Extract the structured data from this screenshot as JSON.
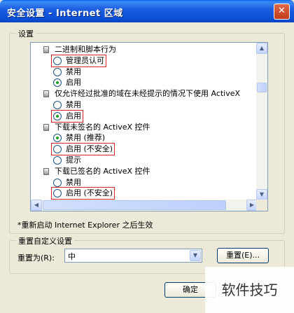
{
  "window": {
    "title": "安全设置 - Internet 区域",
    "close_glyph": "✕"
  },
  "settings_group": {
    "label": "设置"
  },
  "settings_list": [
    {
      "kind": "category",
      "text": "二进制和脚本行为"
    },
    {
      "kind": "option",
      "text": "管理员认可",
      "checked": false,
      "highlighted": true
    },
    {
      "kind": "option",
      "text": "禁用",
      "checked": false,
      "highlighted": false
    },
    {
      "kind": "option",
      "text": "启用",
      "checked": true,
      "highlighted": false
    },
    {
      "kind": "category",
      "text": "仅允许经过批准的域在未经提示的情况下使用 ActiveX"
    },
    {
      "kind": "option",
      "text": "禁用",
      "checked": false,
      "highlighted": false
    },
    {
      "kind": "option",
      "text": "启用",
      "checked": true,
      "highlighted": true
    },
    {
      "kind": "category",
      "text": "下载未签名的 ActiveX 控件"
    },
    {
      "kind": "option",
      "text": "禁用 (推荐)",
      "checked": true,
      "highlighted": false
    },
    {
      "kind": "option",
      "text": "启用 (不安全)",
      "checked": false,
      "highlighted": true
    },
    {
      "kind": "option",
      "text": "提示",
      "checked": false,
      "highlighted": false
    },
    {
      "kind": "category",
      "text": "下载已签名的 ActiveX 控件"
    },
    {
      "kind": "option",
      "text": "禁用",
      "checked": false,
      "highlighted": false
    },
    {
      "kind": "option",
      "text": "启用 (不安全)",
      "checked": false,
      "highlighted": true
    }
  ],
  "restart_note": "*重新启动 Internet Explorer 之后生效",
  "reset_group": {
    "label": "重置自定义设置",
    "reset_to_label": "重置为(R):",
    "selected_level": "中",
    "reset_button": "重置(E)..."
  },
  "buttons": {
    "ok": "确定"
  },
  "watermark": "软件技巧",
  "colors": {
    "title_bar": "#0b4fd6",
    "highlight_box": "#d82424",
    "dialog_bg": "#ece9d8",
    "radio_dot": "#21a121"
  }
}
